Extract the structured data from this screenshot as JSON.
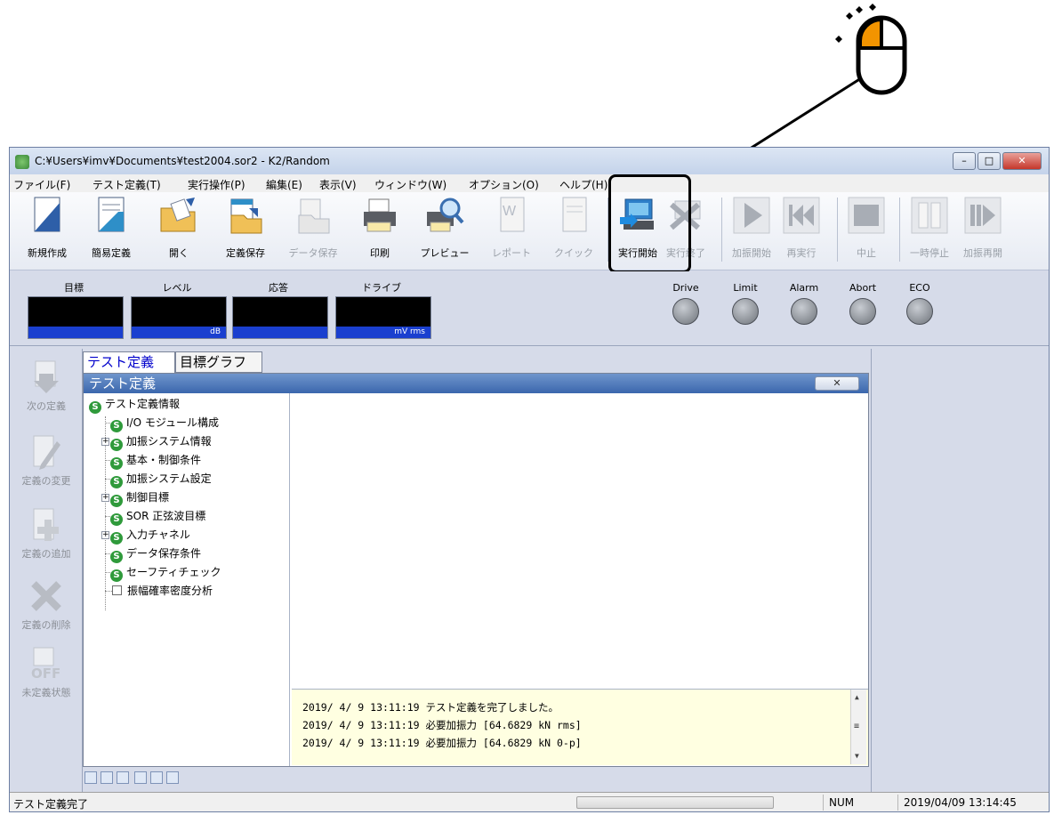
{
  "window": {
    "title": "C:¥Users¥imv¥Documents¥test2004.sor2 - K2/Random",
    "minimize": "–",
    "maximize": "□",
    "close": "✕"
  },
  "menu": [
    "ファイル(F)",
    "テスト定義(T)",
    "実行操作(P)",
    "編集(E)",
    "表示(V)",
    "ウィンドウ(W)",
    "オプション(O)",
    "ヘルプ(H)"
  ],
  "toolbar": [
    {
      "label": "新規作成",
      "enabled": true,
      "icon": "new-document-icon"
    },
    {
      "label": "簡易定義",
      "enabled": true,
      "icon": "quick-define-icon"
    },
    {
      "label": "開く",
      "enabled": true,
      "icon": "open-folder-icon"
    },
    {
      "label": "定義保存",
      "enabled": true,
      "icon": "save-definition-icon"
    },
    {
      "label": "データ保存",
      "enabled": false,
      "icon": "save-data-icon"
    },
    {
      "label": "印刷",
      "enabled": true,
      "icon": "printer-icon"
    },
    {
      "label": "プレビュー",
      "enabled": true,
      "icon": "preview-icon"
    },
    {
      "label": "レポート",
      "enabled": false,
      "icon": "report-icon"
    },
    {
      "label": "クイック",
      "enabled": false,
      "icon": "quick-icon"
    },
    {
      "label": "実行開始",
      "enabled": true,
      "icon": "run-start-icon"
    },
    {
      "label": "実行終了",
      "enabled": false,
      "icon": "run-end-icon"
    },
    {
      "label": "加振開始",
      "enabled": false,
      "icon": "play-icon"
    },
    {
      "label": "再実行",
      "enabled": false,
      "icon": "rewind-icon"
    },
    {
      "label": "中止",
      "enabled": false,
      "icon": "stop-icon"
    },
    {
      "label": "一時停止",
      "enabled": false,
      "icon": "pause-icon"
    },
    {
      "label": "加振再開",
      "enabled": false,
      "icon": "resume-icon"
    }
  ],
  "meters": [
    {
      "label": "目標",
      "unit": ""
    },
    {
      "label": "レベル",
      "unit": "dB"
    },
    {
      "label": "応答",
      "unit": ""
    },
    {
      "label": "ドライブ",
      "unit": "mV rms"
    }
  ],
  "lamps": [
    "Drive",
    "Limit",
    "Alarm",
    "Abort",
    "ECO"
  ],
  "sidebar": [
    {
      "label": "次の定義",
      "icon": "down-arrow-icon"
    },
    {
      "label": "定義の変更",
      "icon": "pencil-icon"
    },
    {
      "label": "定義の追加",
      "icon": "add-icon"
    },
    {
      "label": "定義の削除",
      "icon": "delete-icon"
    },
    {
      "label": "未定義状態",
      "icon": "off-icon"
    }
  ],
  "tabs": [
    "テスト定義",
    "目標グラフ"
  ],
  "panel": {
    "title": "テスト定義",
    "close": "✕"
  },
  "tree": [
    {
      "label": "テスト定義情報",
      "level": 0,
      "icon": "s",
      "expander": false
    },
    {
      "label": "I/O モジュール構成",
      "level": 1,
      "icon": "s",
      "expander": false
    },
    {
      "label": "加振システム情報",
      "level": 1,
      "icon": "s",
      "expander": true
    },
    {
      "label": "基本・制御条件",
      "level": 1,
      "icon": "s",
      "expander": false
    },
    {
      "label": "加振システム設定",
      "level": 1,
      "icon": "s",
      "expander": false
    },
    {
      "label": "制御目標",
      "level": 1,
      "icon": "s",
      "expander": true
    },
    {
      "label": "SOR 正弦波目標",
      "level": 1,
      "icon": "s",
      "expander": false
    },
    {
      "label": "入力チャネル",
      "level": 1,
      "icon": "s",
      "expander": true
    },
    {
      "label": "データ保存条件",
      "level": 1,
      "icon": "s",
      "expander": false
    },
    {
      "label": "セーフティチェック",
      "level": 1,
      "icon": "s",
      "expander": false
    },
    {
      "label": "振幅確率密度分析",
      "level": 1,
      "icon": "checkbox",
      "expander": false
    }
  ],
  "s_glyph": "S",
  "log": [
    "2019/ 4/ 9 13:11:19 テスト定義を完了しました。",
    "2019/ 4/ 9 13:11:19 必要加振力 [64.6829 kN rms]",
    "2019/ 4/ 9 13:11:19 必要加振力 [64.6829 kN 0-p]"
  ],
  "status": {
    "text": "テスト定義完了",
    "num": "NUM",
    "datetime": "2019/04/09 13:14:45"
  }
}
